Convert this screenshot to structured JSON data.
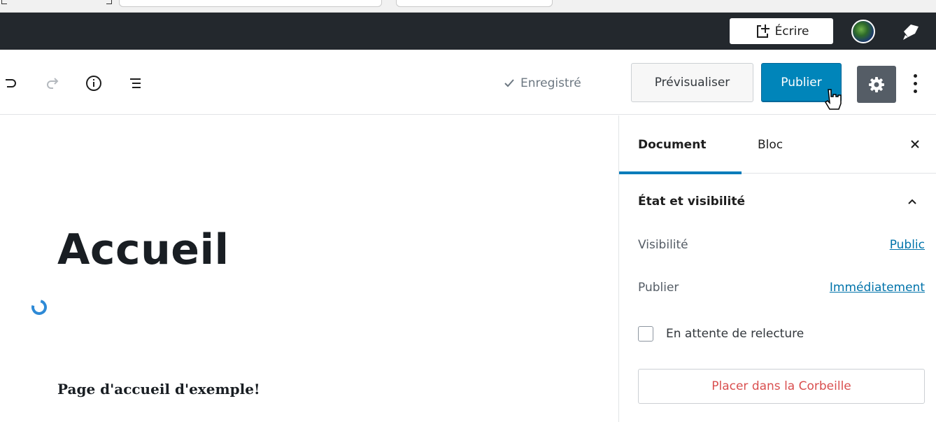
{
  "admin_bar": {
    "write_label": "Écrire",
    "icons": [
      "new-post-icon",
      "avatar",
      "notification-icon"
    ]
  },
  "header": {
    "tools": [
      "undo-icon",
      "redo-icon",
      "info-icon",
      "outline-icon"
    ],
    "saved_label": "Enregistré",
    "preview_label": "Prévisualiser",
    "publish_label": "Publier",
    "settings_icon": "gear-icon",
    "more_icon": "more-vertical-icon"
  },
  "editor": {
    "title": "Accueil",
    "paragraph": "Page d'accueil d'exemple!"
  },
  "sidebar": {
    "tabs": [
      {
        "label": "Document",
        "active": true
      },
      {
        "label": "Bloc",
        "active": false
      }
    ],
    "panel_title": "État et visibilité",
    "visibility_label": "Visibilité",
    "visibility_value": "Public",
    "publish_label": "Publier",
    "publish_value": "Immédiatement",
    "pending_review_label": "En attente de relecture",
    "pending_review_checked": false,
    "trash_label": "Placer dans la Corbeille"
  },
  "colors": {
    "admin_bar": "#23282d",
    "primary": "#0085ba",
    "accent_tab": "#007cba",
    "link": "#0073aa",
    "danger": "#d94f4f"
  }
}
